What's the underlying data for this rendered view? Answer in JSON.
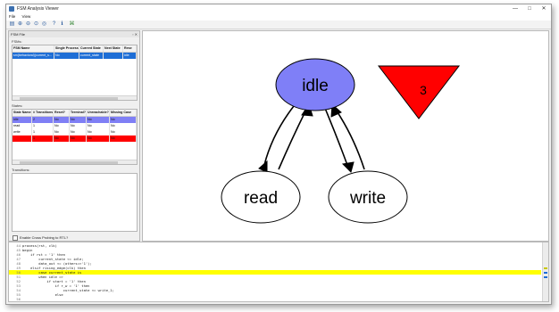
{
  "window": {
    "title": "FSM Analysis Viewer",
    "minimize": "—",
    "maximize": "□",
    "close": "✕"
  },
  "menu": [
    "File",
    "View"
  ],
  "toolbar": [
    "open-icon",
    "zoom-in-icon",
    "zoom-out-icon",
    "zoom-fit-icon",
    "zoom-reset-icon",
    "help-icon",
    "info-icon",
    "graph-icon"
  ],
  "dock": {
    "title": "FSM File",
    "fsms_label": "FSMs:",
    "fsm_columns": [
      "FSM Name",
      "Single Process?",
      "Current State",
      "Next State",
      "Rese"
    ],
    "fsm_rows": [
      [
        "sm(behavioral)(current_s...",
        "No",
        "current_state",
        "",
        "idle"
      ]
    ],
    "states_label": "States:",
    "state_columns": [
      "State Name",
      "# Transitions",
      "Reset?",
      "Terminal?",
      "Unreachable?",
      "Missing Case"
    ],
    "state_rows": [
      [
        "idle",
        "2",
        "No",
        "No",
        "No",
        "No"
      ],
      [
        "read",
        "1",
        "No",
        "No",
        "No",
        "No"
      ],
      [
        "write",
        "1",
        "No",
        "No",
        "No",
        "No"
      ],
      [
        "",
        "1",
        "No",
        "No",
        "No",
        "No"
      ]
    ],
    "transitions_label": "Transitions:",
    "checkbox_label": "Enable Cross Probing to RTL?"
  },
  "graph": {
    "nodes": [
      {
        "id": "idle",
        "label": "idle",
        "color": "#7f7ff7"
      },
      {
        "id": "read",
        "label": "read",
        "color": "#ffffff"
      },
      {
        "id": "write",
        "label": "write",
        "color": "#ffffff"
      }
    ],
    "warning_label": "3",
    "warning_color": "#ff0000"
  },
  "code": {
    "lines": [
      {
        "n": "44",
        "text": "process(rst, clk)"
      },
      {
        "n": "45",
        "text": "begin"
      },
      {
        "n": "46",
        "text": "    if rst = '1' then"
      },
      {
        "n": "47",
        "text": "        current_state <= idle;"
      },
      {
        "n": "48",
        "text": "        data_out <= (others=>'1');"
      },
      {
        "n": "49",
        "text": "    elsif rising_edge(clk) then"
      },
      {
        "n": "50",
        "text": "        case current_state is",
        "hl": true
      },
      {
        "n": "51",
        "text": "        when idle =>"
      },
      {
        "n": "52",
        "text": "            if start = '1' then"
      },
      {
        "n": "53",
        "text": "                if r_w = '1' then"
      },
      {
        "n": "54",
        "text": "                    current_state <= write_1;"
      },
      {
        "n": "55",
        "text": "                else"
      },
      {
        "n": "56",
        "text": ""
      }
    ]
  }
}
